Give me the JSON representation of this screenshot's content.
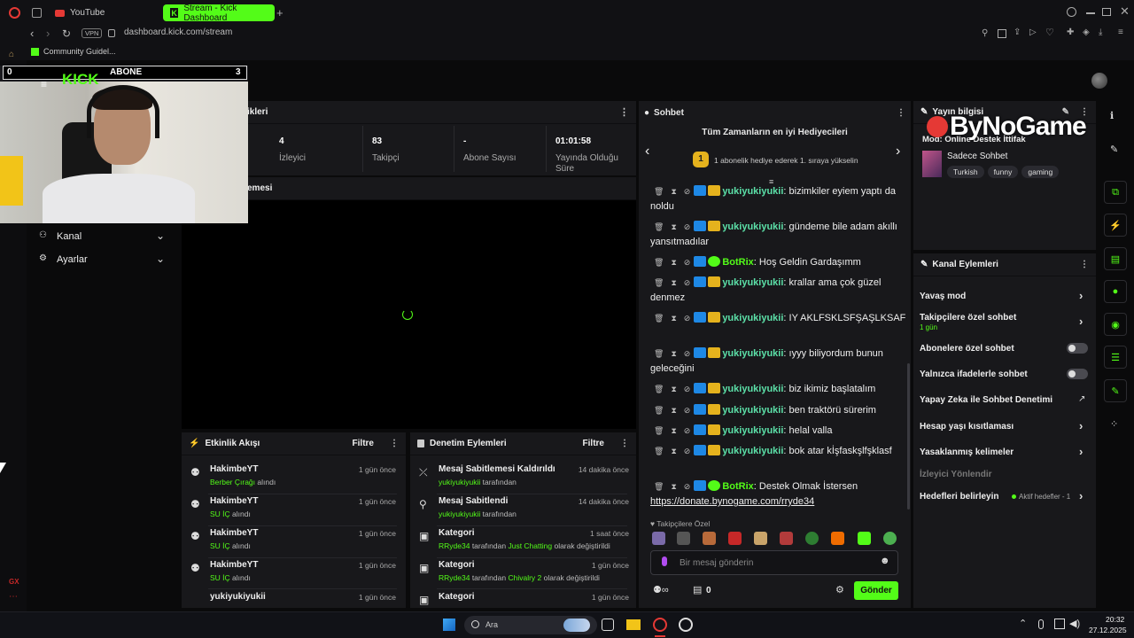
{
  "browser": {
    "tabs": [
      {
        "label": "YouTube"
      },
      {
        "label": "Stream - Kick Dashboard"
      }
    ],
    "url": "dashboard.kick.com/stream",
    "vpn": "VPN",
    "bookmark": "Community Guidel..."
  },
  "webcam_overlay": {
    "left_count": "0",
    "label": "ABONE",
    "right_count": "3"
  },
  "watermark": "ByNoGame",
  "nav": {
    "items": [
      {
        "label": "Kanal"
      },
      {
        "label": "Ayarlar"
      }
    ]
  },
  "stats_panel": {
    "title": "ikleri",
    "stats": [
      {
        "value": "4",
        "label": "İzleyici"
      },
      {
        "value": "83",
        "label": "Takipçi"
      },
      {
        "value": "-",
        "label": "Abone Sayısı"
      },
      {
        "value": "01:01:58",
        "label": "Yayında Olduğu Süre"
      }
    ]
  },
  "preview_panel": {
    "title": "emesi"
  },
  "activity": {
    "title": "Etkinlik Akışı",
    "filter": "Filtre",
    "items": [
      {
        "user": "HakimbeYT",
        "item": "Berber Çırağı",
        "action": "alındı",
        "time": "1 gün önce"
      },
      {
        "user": "HakimbeYT",
        "item": "SU İÇ",
        "action": "alındı",
        "time": "1 gün önce"
      },
      {
        "user": "HakimbeYT",
        "item": "SU İÇ",
        "action": "alındı",
        "time": "1 gün önce"
      },
      {
        "user": "HakimbeYT",
        "item": "SU İÇ",
        "action": "alındı",
        "time": "1 gün önce"
      },
      {
        "user": "yukiyukiyukii",
        "item": "",
        "action": "",
        "time": "1 gün önce"
      }
    ]
  },
  "moderation": {
    "title": "Denetim Eylemleri",
    "filter": "Filtre",
    "items": [
      {
        "title": "Mesaj Sabitlemesi Kaldırıldı",
        "time": "14 dakika önce",
        "user": "yukiyukiyukii",
        "rest": "tarafından",
        "cat": "",
        "tail": ""
      },
      {
        "title": "Mesaj Sabitlendi",
        "time": "14 dakika önce",
        "user": "yukiyukiyukii",
        "rest": "tarafından",
        "cat": "",
        "tail": ""
      },
      {
        "title": "Kategori",
        "time": "1 saat önce",
        "user": "RRyde34",
        "rest": "tarafından",
        "cat": "Just Chatting",
        "tail": "olarak değiştirildi"
      },
      {
        "title": "Kategori",
        "time": "1 gün önce",
        "user": "RRyde34",
        "rest": "tarafından",
        "cat": "Chivalry 2",
        "tail": "olarak değiştirildi"
      },
      {
        "title": "Kategori",
        "time": "1 gün önce",
        "user": "",
        "rest": "",
        "cat": "",
        "tail": ""
      }
    ]
  },
  "chat": {
    "title": "Sohbet",
    "top_gifters_title": "Tüm Zamanların en iyi Hediyecileri",
    "rank": "1",
    "gift_prompt": "1 abonelik hediye ederek 1. sıraya yükselin",
    "messages": [
      {
        "user": "yukiyukiyukii",
        "text": "bizimkiler eyiem yaptı da noldu"
      },
      {
        "user": "yukiyukiyukii",
        "text": "gündeme bile adam akıllı yansıtmadılar"
      },
      {
        "user": "BotRix",
        "text": "Hoş Geldin Gardaşımm"
      },
      {
        "user": "yukiyukiyukii",
        "text": "krallar ama çok güzel denmez"
      },
      {
        "user": "yukiyukiyukii",
        "text": "IY AKLFSKLSFŞAŞLKSAF"
      },
      {
        "user": "yukiyukiyukii",
        "text": "ıyyy biliyordum bunun geleceğini"
      },
      {
        "user": "yukiyukiyukii",
        "text": "biz ikimiz başlatalım"
      },
      {
        "user": "yukiyukiyukii",
        "text": "ben traktörü sürerim"
      },
      {
        "user": "yukiyukiyukii",
        "text": "helal valla"
      },
      {
        "user": "yukiyukiyukii",
        "text": "bok atar kİşfaskşlfşklasf"
      },
      {
        "user": "BotRix",
        "text": "Destek Olmak İstersen"
      }
    ],
    "donate_link": "https://donate.bynogame.com/rryde34",
    "followers_only": "Takipçilere Özel",
    "input_placeholder": "Bir mesaj gönderin",
    "count": "0",
    "send": "Gönder"
  },
  "stream_info": {
    "title": "Yayın bilgisi",
    "mode_line": "Mod: Online Destek İttifak",
    "mode": "Sadece Sohbet",
    "tags": [
      "Turkish",
      "funny",
      "gaming"
    ]
  },
  "channel_actions": {
    "title": "Kanal Eylemleri",
    "items": [
      {
        "label": "Yavaş mod",
        "sub": "",
        "control": "chevron"
      },
      {
        "label": "Takipçilere özel sohbet",
        "sub": "1 gün",
        "control": "chevron"
      },
      {
        "label": "Abonelere özel sohbet",
        "sub": "",
        "control": "toggle"
      },
      {
        "label": "Yalnızca ifadelerle sohbet",
        "sub": "",
        "control": "toggle"
      },
      {
        "label": "Yapay Zeka ile Sohbet Denetimi",
        "sub": "",
        "control": "external"
      },
      {
        "label": "Hesap yaşı kısıtlaması",
        "sub": "",
        "control": "chevron"
      },
      {
        "label": "Yasaklanmış kelimeler",
        "sub": "",
        "control": "chevron"
      }
    ],
    "section": "İzleyici Yönlendir",
    "goals_label": "Hedefleri belirleyin",
    "goals_status": "Aktif hedefler - 1"
  },
  "taskbar": {
    "search": "Ara",
    "time": "20:32",
    "date": "27.12.2025"
  },
  "colors": {
    "accent": "#53fc18",
    "panel": "#18181b",
    "bg": "#0a0a0b"
  }
}
